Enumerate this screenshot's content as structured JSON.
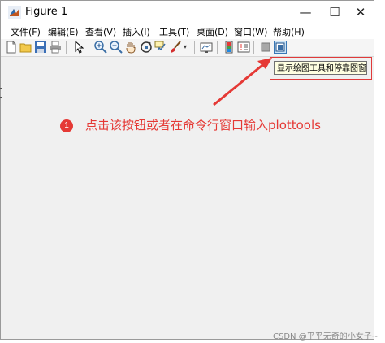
{
  "window": {
    "title": "Figure 1",
    "controls": {
      "minimize": "—",
      "maximize": "☐",
      "close": "✕"
    }
  },
  "menubar": {
    "items": [
      "文件(F)",
      "编辑(E)",
      "查看(V)",
      "插入(I)",
      "工具(T)",
      "桌面(D)",
      "窗口(W)",
      "帮助(H)"
    ]
  },
  "toolbar": {
    "buttons": [
      "new-figure-icon",
      "open-file-icon",
      "save-icon",
      "print-icon",
      "select-arrow-icon",
      "zoom-in-icon",
      "zoom-out-icon",
      "pan-hand-icon",
      "rotate-3d-icon",
      "data-cursor-icon",
      "brush-icon",
      "link-plot-icon",
      "insert-colorbar-icon",
      "insert-legend-icon",
      "hide-plot-tools-icon",
      "show-plot-tools-icon"
    ]
  },
  "tooltip": {
    "text": "显示绘图工具和停靠图窗"
  },
  "annotation": {
    "badge": "1",
    "text": "点击该按钮或者在命令行窗口输入plottools",
    "color": "#e53935"
  },
  "watermark": "CSDN @平平无奇的小女子~"
}
